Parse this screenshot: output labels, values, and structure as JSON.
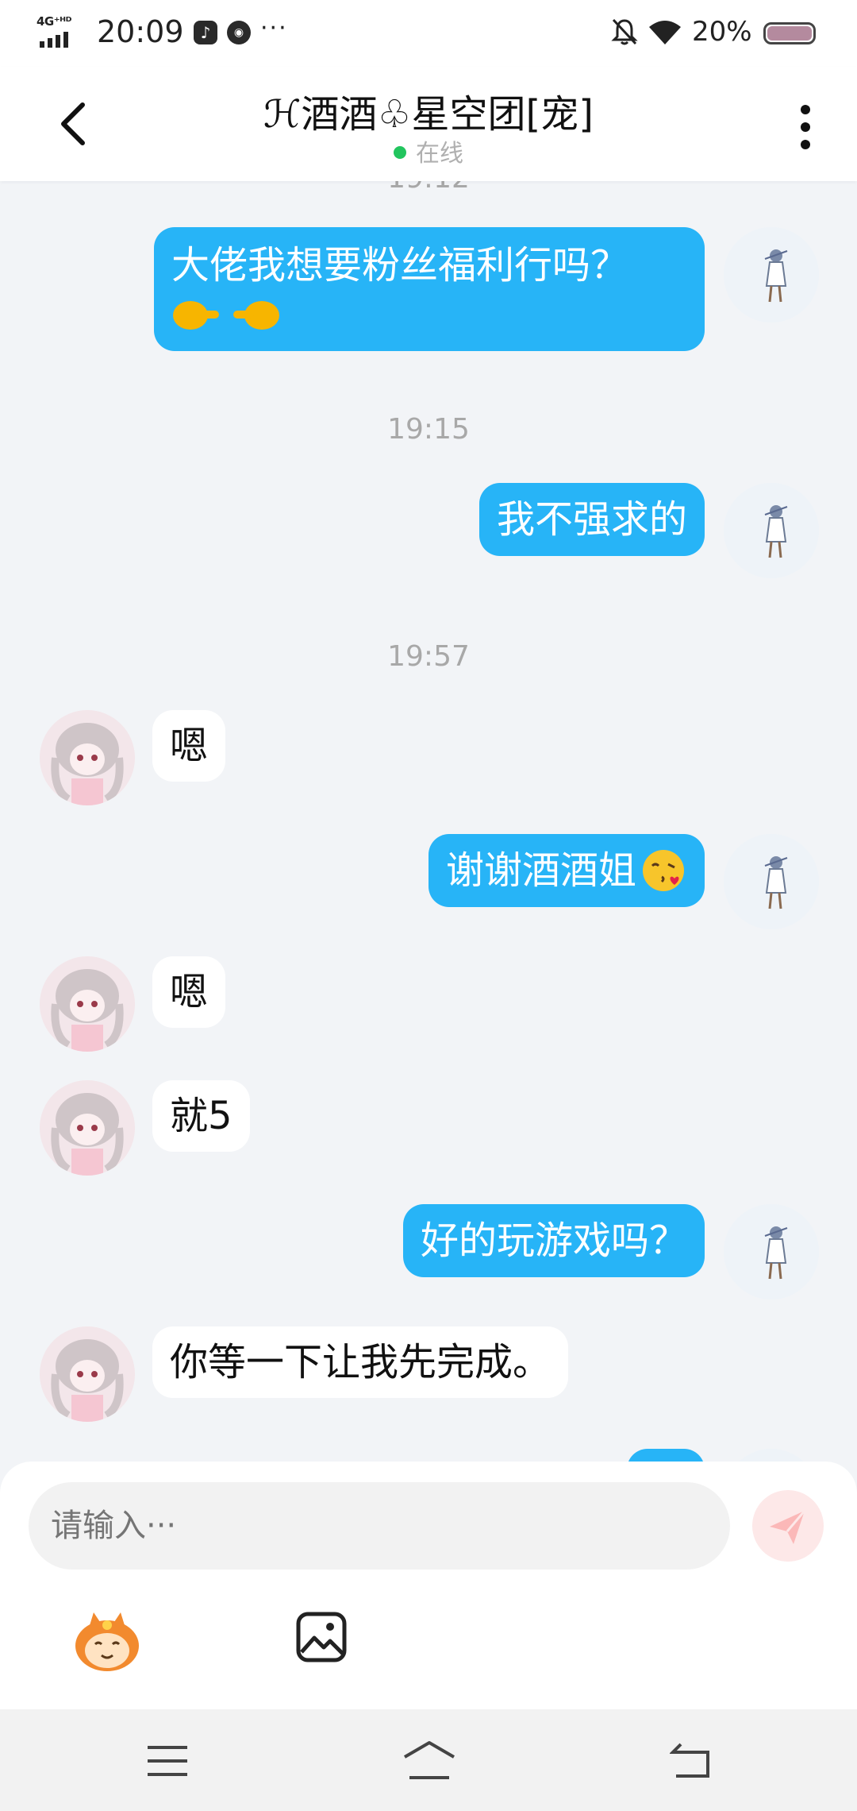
{
  "status_bar": {
    "network": "4G⁺ᴴᴰ",
    "time": "20:09",
    "more": "···",
    "battery": "20%",
    "battery_level": 0.2
  },
  "header": {
    "title": "ℋ酒酒♧星空团[宠]",
    "status": "在线"
  },
  "chat": {
    "partial_timestamp": "19:12",
    "messages": [
      {
        "id": "m1",
        "from": "me",
        "text": "大佬我想要粉丝福利行吗？",
        "emoji": "👉👈"
      },
      {
        "id": "t1",
        "type": "timestamp",
        "text": "19:15"
      },
      {
        "id": "m2",
        "from": "me",
        "text": "我不强求的"
      },
      {
        "id": "t2",
        "type": "timestamp",
        "text": "19:57"
      },
      {
        "id": "m3",
        "from": "her",
        "text": "嗯"
      },
      {
        "id": "m4",
        "from": "me",
        "text": "谢谢酒酒姐",
        "emoji": "😘"
      },
      {
        "id": "m5",
        "from": "her",
        "text": "嗯"
      },
      {
        "id": "m6",
        "from": "her",
        "text": "就5"
      },
      {
        "id": "m7",
        "from": "me",
        "text": "好的玩游戏吗？"
      },
      {
        "id": "m8",
        "from": "her",
        "text": "你等一下让我先完成。"
      }
    ]
  },
  "input": {
    "placeholder": "请输入···"
  },
  "icons": {
    "back": "chevron-left-icon",
    "menu": "more-vertical-icon",
    "send": "paper-plane-icon",
    "mascot": "mascot-emoji-icon",
    "image": "image-icon"
  },
  "colors": {
    "bubble_me": "#27b4f7",
    "bubble_her": "#ffffff",
    "background": "#f2f4f7",
    "online_dot": "#22c55e"
  }
}
